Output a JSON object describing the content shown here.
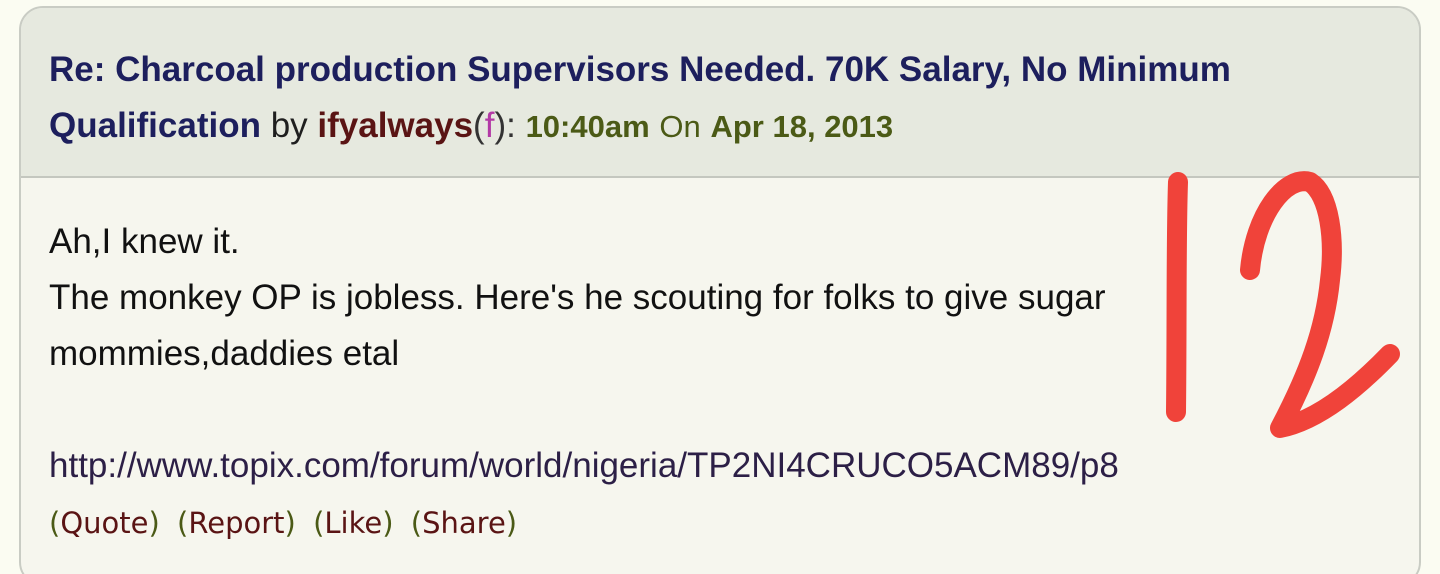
{
  "post": {
    "title": "Re: Charcoal production Supervisors Needed. 70K Salary, No Minimum Qualification",
    "by_label": " by ",
    "author": "ifyalways",
    "paren_open": "(",
    "gender": "f",
    "paren_close": "):",
    "time": "10:40am",
    "on_label": "On",
    "date": "Apr 18, 2013",
    "body_lines": [
      "Ah,I knew it.",
      "The monkey OP is jobless. Here's he scouting for folks to give sugar",
      "mommies,daddies etal"
    ],
    "link": "http://www.topix.com/forum/world/nigeria/TP2NI4CRUCO5ACM89/p8"
  },
  "actions": {
    "quote": "Quote",
    "report": "Report",
    "like": "Like",
    "share": "Share"
  },
  "annotation": {
    "text": "12",
    "color": "#f0433a"
  },
  "colors": {
    "title": "#1d1f5d",
    "author": "#5a1414",
    "gender": "#b33aa6",
    "timestamp": "#4b5a16",
    "header_bg": "#e6e9df",
    "body_bg": "#f6f6ee"
  }
}
